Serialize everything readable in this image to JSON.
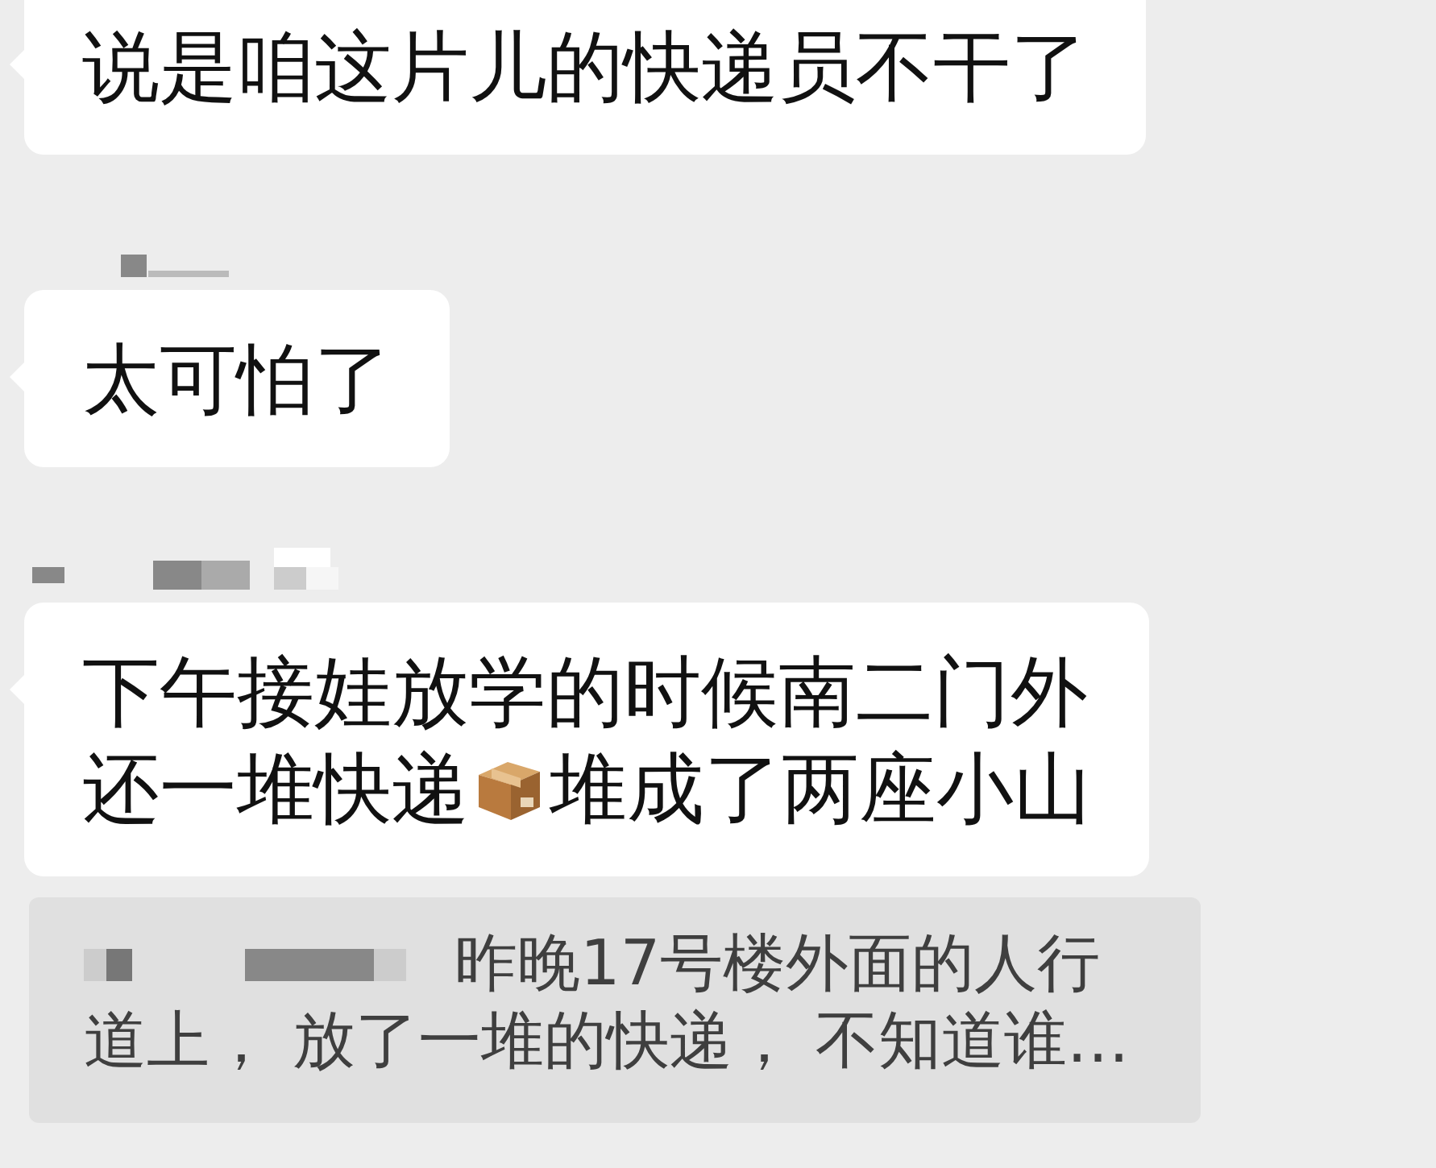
{
  "messages": [
    {
      "sender_redacted": false,
      "lines": [
        [
          {
            "kind": "text",
            "text": "说是咱这片儿的快递员不干了"
          }
        ]
      ]
    },
    {
      "sender_redacted": true,
      "lines": [
        [
          {
            "kind": "text",
            "text": "太可怕了"
          }
        ]
      ]
    },
    {
      "sender_redacted": true,
      "lines": [
        [
          {
            "kind": "text",
            "text": "下午接娃放学的时候南二门外"
          }
        ],
        [
          {
            "kind": "text",
            "text": "还一堆快递"
          },
          {
            "kind": "package_emoji"
          },
          {
            "kind": "text",
            "text": "堆成了两座小山"
          }
        ]
      ]
    }
  ],
  "quote": {
    "sender_redacted": true,
    "lines": [
      "昨晚17号楼外面的人行",
      "道上， 放了一堆的快递， 不知道谁…"
    ]
  }
}
